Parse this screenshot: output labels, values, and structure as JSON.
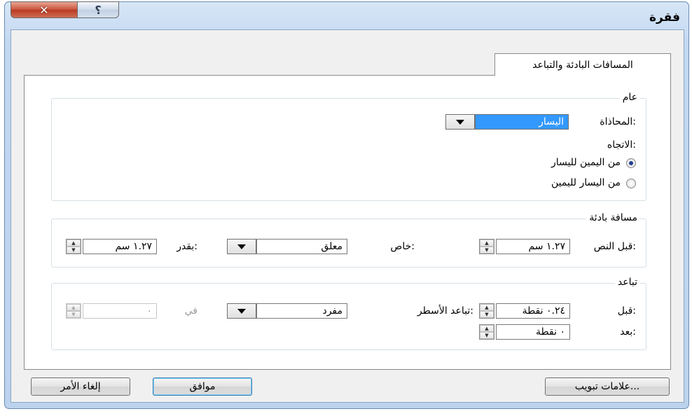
{
  "window": {
    "title": "فقرة",
    "close_glyph": "✕",
    "help_glyph": "؟"
  },
  "tab": {
    "label": "المسافات البادئة والتباعد"
  },
  "general": {
    "legend": "عام",
    "alignment_label": "المحاذاة:",
    "alignment_value": "اليسار",
    "direction_label": "الاتجاه:",
    "rtl_option": "من اليمين لليسار",
    "ltr_option": "من اليسار لليمين",
    "rtl_selected": true
  },
  "indent": {
    "legend": "مسافة بادئة",
    "before_text_label": "قبل النص:",
    "before_text_value": "١.٢٧ سم",
    "special_label": "خاص:",
    "special_value": "معلق",
    "by_label": "بقدر:",
    "by_value": "١.٢٧ سم"
  },
  "spacing": {
    "legend": "تباعد",
    "before_label": "قبل:",
    "before_value": "٠.٢٤ نقطة",
    "after_label": "بعد:",
    "after_value": "٠ نقطة",
    "line_spacing_label": "تباعد الأسطر:",
    "line_spacing_value": "مفرد",
    "at_label": "في",
    "at_value": "٠"
  },
  "buttons": {
    "tabs": "علامات تبويب...",
    "ok": "موافق",
    "cancel": "إلغاء الأمر"
  },
  "colors": {
    "selection": "#3399ff",
    "radio_dot": "#1f3f8f"
  }
}
